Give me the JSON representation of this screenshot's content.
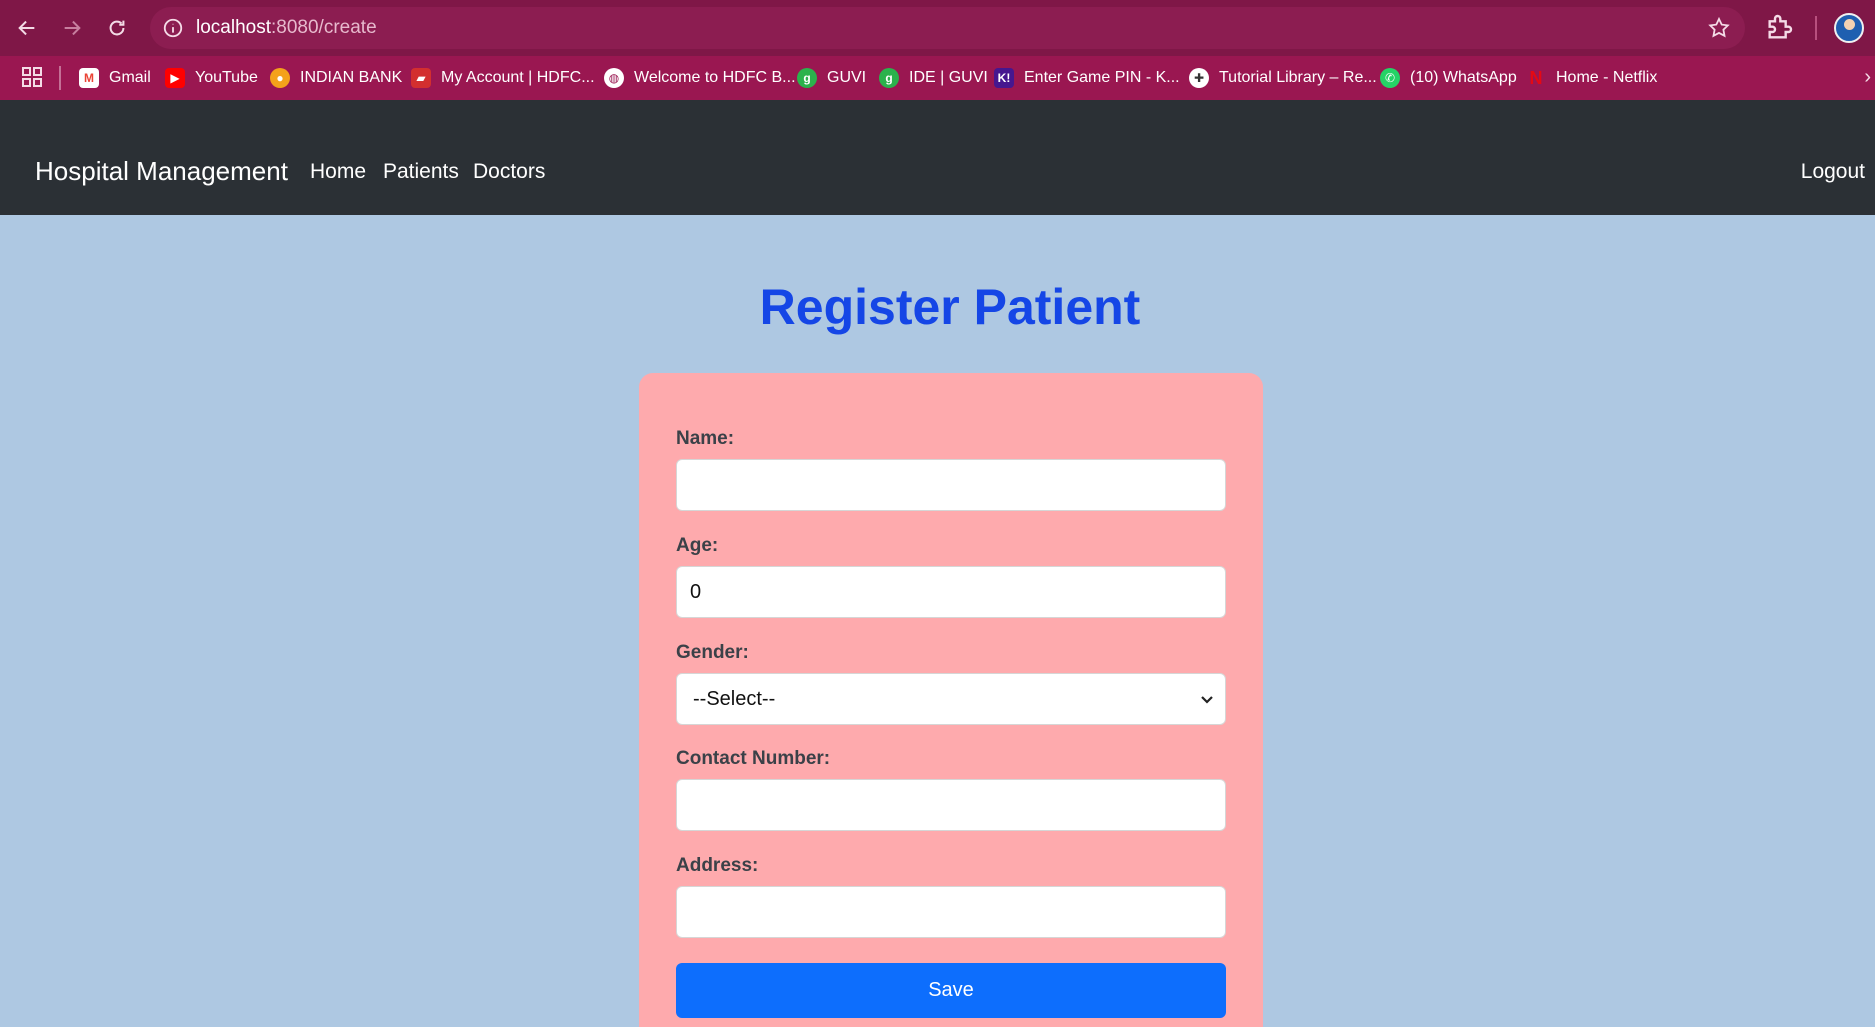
{
  "browser": {
    "url_host": "localhost",
    "url_path": ":8080/create",
    "bookmarks": [
      {
        "label": "Gmail",
        "icon": "gmail-icon",
        "color": "#ea4335"
      },
      {
        "label": "YouTube",
        "icon": "youtube-icon",
        "color": "#ff0000"
      },
      {
        "label": "INDIAN BANK",
        "icon": "indian-bank-icon",
        "color": "#f4a21b"
      },
      {
        "label": "My Account | HDFC...",
        "icon": "hdfc-icon",
        "color": "#d32f2f"
      },
      {
        "label": "Welcome to HDFC B...",
        "icon": "globe-icon",
        "color": "#ffffff"
      },
      {
        "label": "GUVI",
        "icon": "guvi-icon",
        "color": "#2bb24c"
      },
      {
        "label": "IDE | GUVI",
        "icon": "guvi-icon",
        "color": "#2bb24c"
      },
      {
        "label": "Enter Game PIN - K...",
        "icon": "kahoot-icon",
        "color": "#46178f"
      },
      {
        "label": "Tutorial Library – Re...",
        "icon": "tutorial-icon",
        "color": "#ffffff"
      },
      {
        "label": "(10) WhatsApp",
        "icon": "whatsapp-icon",
        "color": "#25d366"
      },
      {
        "label": "Home - Netflix",
        "icon": "netflix-icon",
        "color": "#e50914"
      }
    ]
  },
  "navbar": {
    "brand": "Hospital Management",
    "links": [
      "Home",
      "Patients",
      "Doctors"
    ],
    "logout": "Logout"
  },
  "form": {
    "title": "Register Patient",
    "name_label": "Name:",
    "name_value": "",
    "age_label": "Age:",
    "age_value": "0",
    "gender_label": "Gender:",
    "gender_selected": "--Select--",
    "contact_label": "Contact Number:",
    "contact_value": "",
    "address_label": "Address:",
    "address_value": "",
    "save_label": "Save"
  }
}
